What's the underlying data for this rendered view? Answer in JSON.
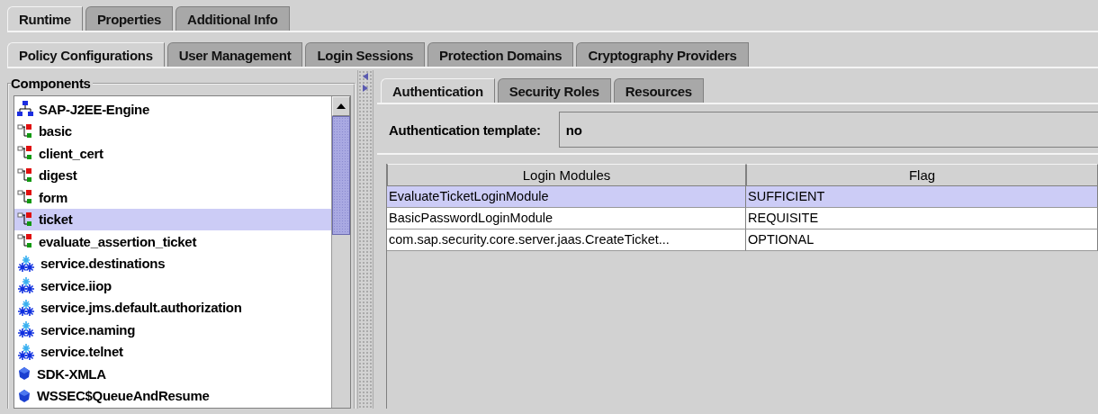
{
  "main_tabs": [
    {
      "label": "Runtime",
      "selected": true
    },
    {
      "label": "Properties",
      "selected": false
    },
    {
      "label": "Additional Info",
      "selected": false
    }
  ],
  "sub_tabs": [
    {
      "label": "Policy Configurations",
      "selected": true
    },
    {
      "label": "User Management",
      "selected": false
    },
    {
      "label": "Login Sessions",
      "selected": false
    },
    {
      "label": "Protection Domains",
      "selected": false
    },
    {
      "label": "Cryptography Providers",
      "selected": false
    }
  ],
  "components": {
    "title": "Components",
    "items": [
      {
        "label": "SAP-J2EE-Engine",
        "kind": "root",
        "selected": false
      },
      {
        "label": "basic",
        "kind": "policy",
        "selected": false
      },
      {
        "label": "client_cert",
        "kind": "policy",
        "selected": false
      },
      {
        "label": "digest",
        "kind": "policy",
        "selected": false
      },
      {
        "label": "form",
        "kind": "policy",
        "selected": false
      },
      {
        "label": "ticket",
        "kind": "policy",
        "selected": true
      },
      {
        "label": "evaluate_assertion_ticket",
        "kind": "policy",
        "selected": false
      },
      {
        "label": "service.destinations",
        "kind": "service",
        "selected": false
      },
      {
        "label": "service.iiop",
        "kind": "service",
        "selected": false
      },
      {
        "label": "service.jms.default.authorization",
        "kind": "service",
        "selected": false
      },
      {
        "label": "service.naming",
        "kind": "service",
        "selected": false
      },
      {
        "label": "service.telnet",
        "kind": "service",
        "selected": false
      },
      {
        "label": "SDK-XMLA",
        "kind": "component",
        "selected": false
      },
      {
        "label": "WSSEC$QueueAndResume",
        "kind": "component",
        "selected": false
      }
    ]
  },
  "detail_tabs": [
    {
      "label": "Authentication",
      "selected": true
    },
    {
      "label": "Security Roles",
      "selected": false
    },
    {
      "label": "Resources",
      "selected": false
    }
  ],
  "template": {
    "label": "Authentication template:",
    "value": "no"
  },
  "table": {
    "columns": [
      "Login Modules",
      "Flag"
    ],
    "rows": [
      {
        "cells": [
          "EvaluateTicketLoginModule",
          "SUFFICIENT"
        ],
        "selected": true
      },
      {
        "cells": [
          "BasicPasswordLoginModule",
          "REQUISITE"
        ],
        "selected": false
      },
      {
        "cells": [
          "com.sap.security.core.server.jaas.CreateTicket...",
          "OPTIONAL"
        ],
        "selected": false
      }
    ]
  }
}
